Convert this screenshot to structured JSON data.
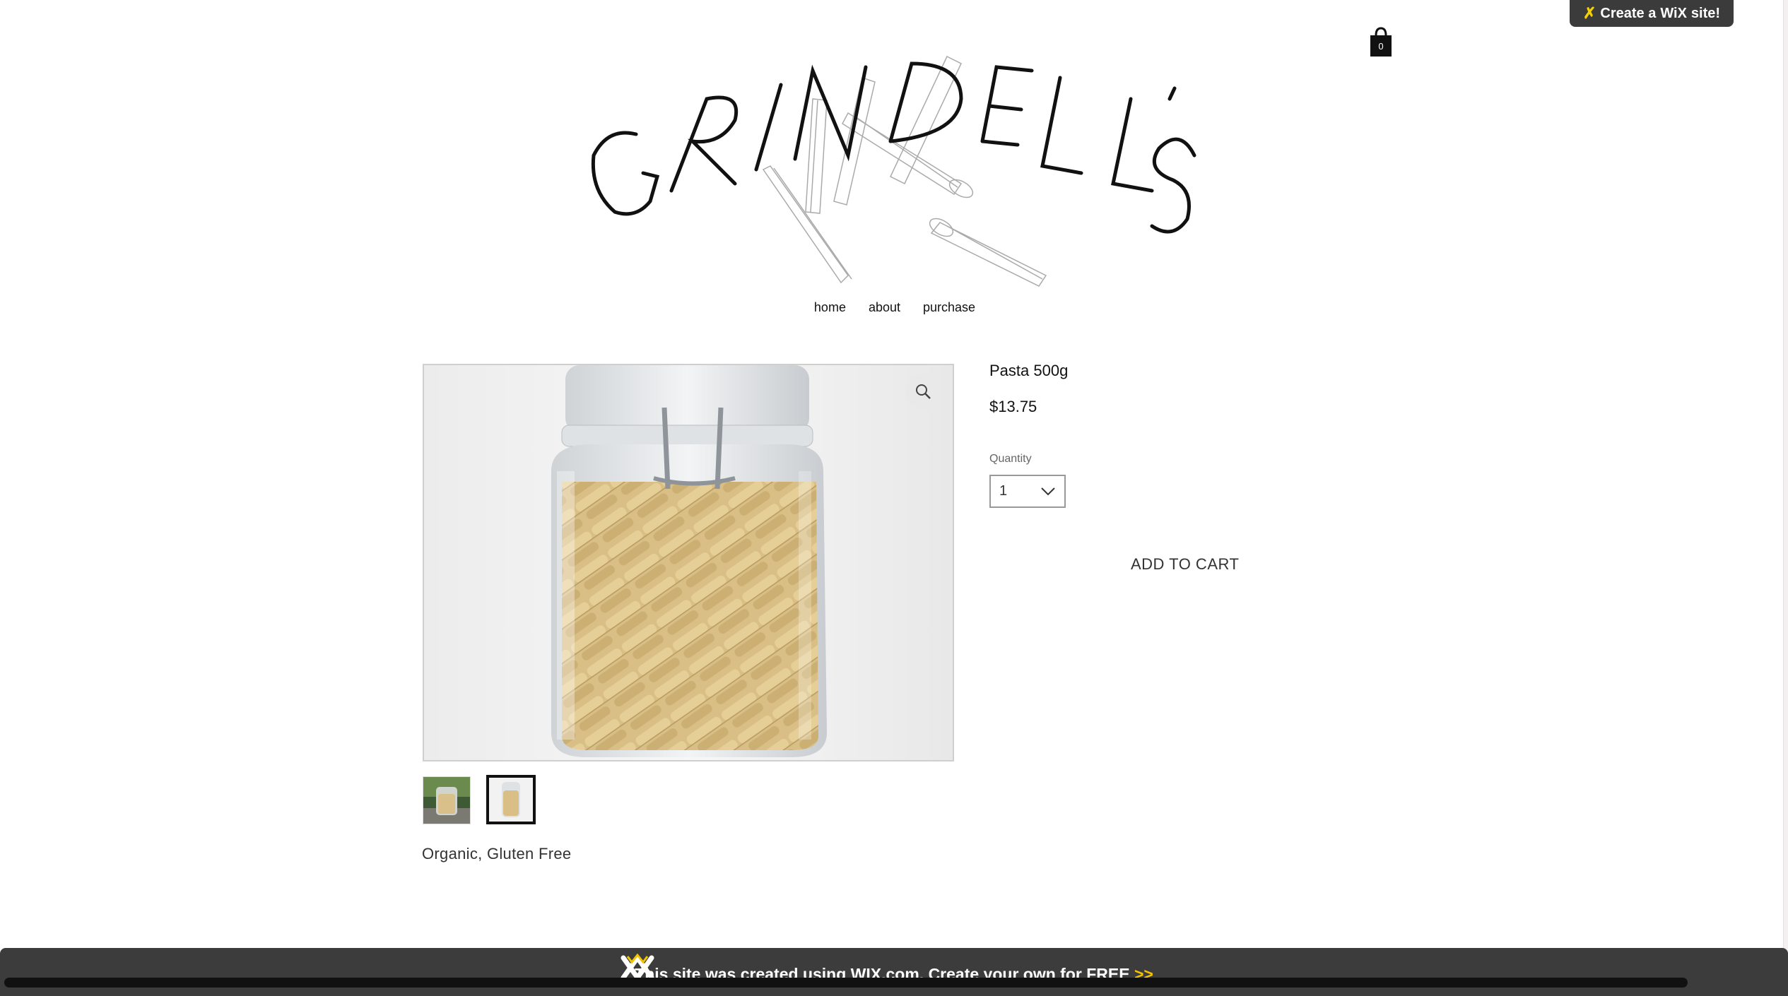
{
  "wix_banner": {
    "prefix": "Create a",
    "brand": "WiX",
    "suffix": "site!"
  },
  "cart": {
    "count": "0"
  },
  "logo": {
    "text": "GRINDELL'S"
  },
  "nav": {
    "items": [
      "home",
      "about",
      "purchase"
    ]
  },
  "product": {
    "title": "Pasta 500g",
    "price": "$13.75",
    "quantity_label": "Quantity",
    "quantity_value": "1",
    "add_to_cart": "ADD TO CART",
    "description": "Organic, Gluten Free"
  },
  "footer": {
    "text": "This site was created using WIX.com. Create your own for FREE",
    "arrow": ">>"
  },
  "colors": {
    "accent": "#f5c400",
    "bar": "#3c3c3c"
  }
}
